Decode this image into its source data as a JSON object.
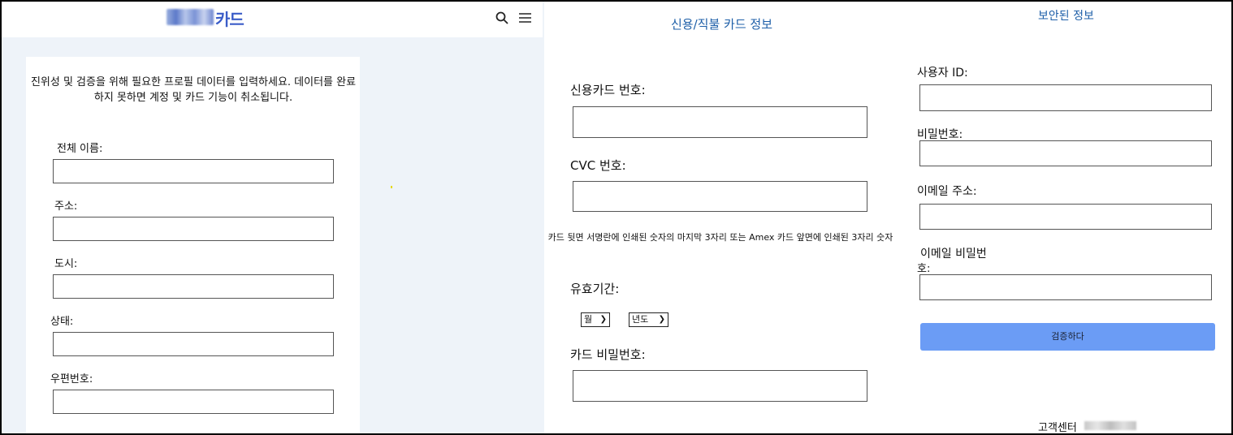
{
  "header": {
    "logo_text": "카드"
  },
  "left": {
    "notice": "진위성 및 검증을 위해 필요한 프로필 데이터를 입력하세요. 데이터를 완료하지 못하면 계정 및 카드 기능이 취소됩니다.",
    "full_name_label": "전체 이름:",
    "address_label": "주소:",
    "city_label": "도시:",
    "state_label": "상태:",
    "zip_label": "우편번호:"
  },
  "middle": {
    "title": "신용/직불 카드 정보",
    "card_number_label": "신용카드 번호:",
    "cvc_label": "CVC 번호:",
    "cvc_help": "카드 뒷면 서명란에 인쇄된 숫자의 마지막 3자리 또는 Amex 카드 앞면에 인쇄된 3자리 숫자",
    "expiry_label": "유효기간:",
    "month_select": "월",
    "year_select": "년도",
    "card_pin_label": "카드 비밀번호:"
  },
  "right": {
    "title": "보안된 정보",
    "user_id_label": "사용자 ID:",
    "password_label": "비밀번호:",
    "email_label": "이메일 주소:",
    "email_password_label_line1": "이메일 비밀번",
    "email_password_label_line2": "호:",
    "verify_button": "검증하다",
    "customer_center": "고객센터"
  }
}
